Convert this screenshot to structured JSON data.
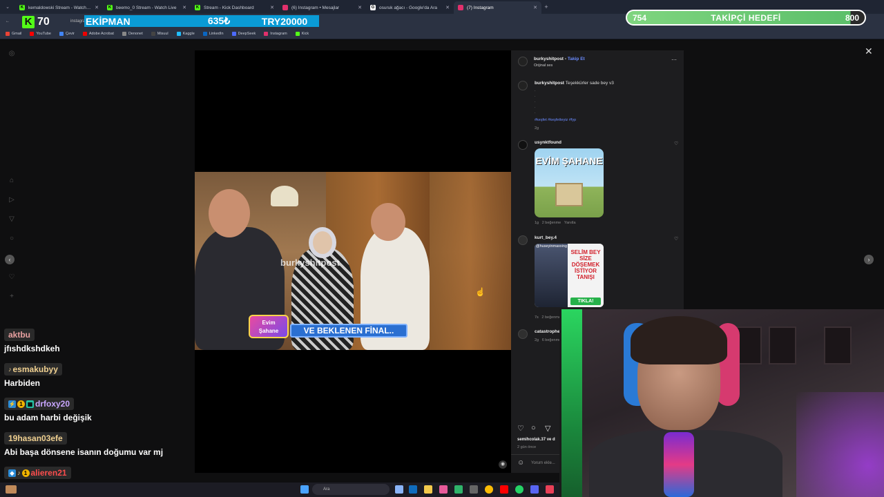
{
  "browser": {
    "tabs": [
      {
        "title": "kemaldowski Stream - Watch Live",
        "color": "#53fc18",
        "icon": "K"
      },
      {
        "title": "beemo_0 Stream - Watch Live",
        "color": "#53fc18",
        "icon": "K"
      },
      {
        "title": "Stream - Kick Dashboard",
        "color": "#53fc18",
        "icon": "K"
      },
      {
        "title": "(6) Instagram • Mesajlar",
        "color": "#e1306c",
        "icon": "◎"
      },
      {
        "title": "osuruk ağacı - Google'da Ara",
        "color": "#ffffff",
        "icon": "G"
      },
      {
        "title": "(7) Instagram",
        "color": "#e1306c",
        "icon": "◎",
        "active": true
      }
    ],
    "url": "instagram.com",
    "bookmarks": [
      "Gmail",
      "YouTube",
      "Çevir",
      "Adobe Acrobat",
      "Denonet",
      "Misuul",
      "Kaggle",
      "LinkedIn",
      "DeepSeek",
      "Instagram",
      "Kick"
    ]
  },
  "overlay": {
    "kick_count": "70",
    "ekipman_label": "EKİPMAN",
    "ekipman_value": "635₺",
    "ekipman_goal": "TRY20000",
    "goal_current": "754",
    "goal_label": "TAKİPÇİ HEDEFİ",
    "goal_target": "800",
    "goal_progress": 0.94
  },
  "video": {
    "watermark": "burkyshitpost",
    "logo_line1": "Evim",
    "logo_line2": "Şahane",
    "banner": "VE BEKLENEN FİNAL.."
  },
  "post": {
    "author": "burkyshitpost",
    "follow": "Takip Et",
    "audio": "Orijinal ses",
    "caption_user": "burkyshitpost",
    "caption": "Teşekkürler sade bey v3",
    "hashtags": "#keşfet #keşfetteyiz #fyp",
    "caption_age": "2g",
    "comments": [
      {
        "user": "usynktfound",
        "sticker_title": "EVİM ŞAHANE",
        "age": "1g",
        "likes": "2 beğenme",
        "reply": "Yanıtla"
      },
      {
        "user": "kurt_bey.4",
        "sticker_caption": "@huseyinmaxxing",
        "sticker_text": "SELİM BEY SİZE DÖŞEMEK İSTİYOR TANIŞI",
        "sticker_button": "TIKLA!",
        "age": "7s",
        "likes": "2 beğenme"
      },
      {
        "user": "catastrophe",
        "age": "2g",
        "likes": "6 beğenme"
      }
    ],
    "liked_by": "semihcolak.37 ve d",
    "post_age": "2 gün önce",
    "comment_placeholder": "Yorum ekle..."
  },
  "chat": [
    {
      "name": "aktbu",
      "color": "#e8a0a0",
      "text": "jfıshdkshdkeh",
      "badges": []
    },
    {
      "name": "esmakubyy",
      "color": "#f0d090",
      "text": "Harbiden",
      "badges": [
        "♪"
      ]
    },
    {
      "name": "drfoxy20",
      "color": "#c9a6ff",
      "text": "bu adam harbi değişik",
      "badges": [
        "⚡",
        "1",
        "▦"
      ]
    },
    {
      "name": "19hasan03efe",
      "color": "#f0d090",
      "text": "Abi başa dönsene isanın doğumu var mj",
      "badges": []
    },
    {
      "name": "alieren21",
      "color": "#ff4d4d",
      "text": "",
      "badges": [
        "◆",
        "♪",
        "1"
      ]
    }
  ],
  "taskbar": {
    "search_placeholder": "Ara"
  },
  "colors": {
    "kick_green": "#53fc18",
    "ig_blue": "#6b8bff",
    "ekipman_bg": "#0a9bd6",
    "goal_green": "#5cbf6a"
  }
}
